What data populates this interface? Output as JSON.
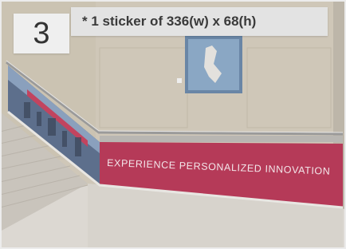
{
  "badge": {
    "number": "3"
  },
  "caption": {
    "text": "* 1 sticker of 336(w) x 68(h)"
  },
  "banner": {
    "text": "EXPERIENCE PERSONALIZED INNOVATION",
    "color": "#b53a58"
  },
  "colors": {
    "wall": "#cfc7b8",
    "floor": "#dcd8d2",
    "stairs": "#c9c4bc",
    "rail": "#9a9a9a"
  }
}
